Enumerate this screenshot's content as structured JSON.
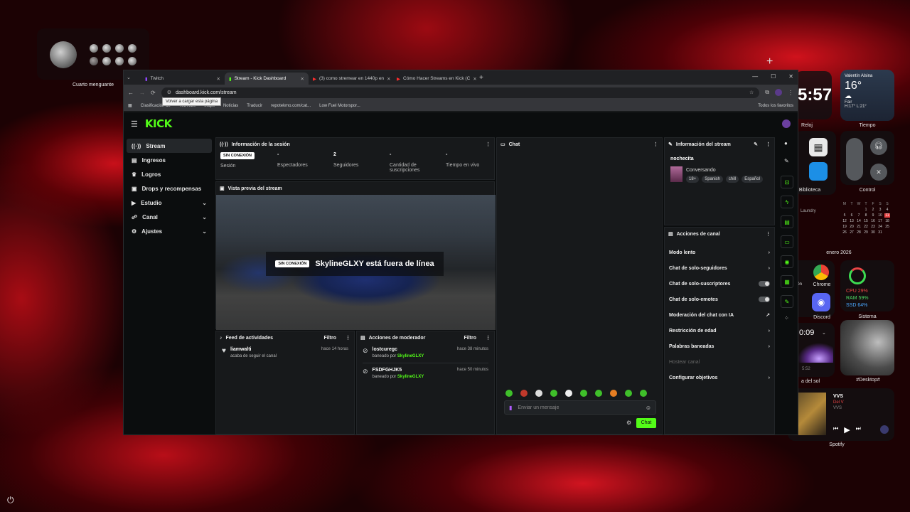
{
  "desktop": {
    "moon_label": "Cuarto menguante",
    "clock": {
      "time": "5:57",
      "label": "Reloj"
    },
    "weather": {
      "user": "Valentín Alsina",
      "temp": "16°",
      "cond": "Fair",
      "range": "H:17° L:21°",
      "label": "Tiempo"
    },
    "biblioteca_label": "Biblioteca",
    "control_label": "Control",
    "laundry": "Laundry",
    "calendar": {
      "label": "enero 2026",
      "days": [
        "M",
        "T",
        "W",
        "T",
        "F",
        "S",
        "S"
      ],
      "rows": [
        [
          "",
          "",
          "",
          "1",
          "2",
          "3",
          "4"
        ],
        [
          "5",
          "6",
          "7",
          "8",
          "9",
          "10",
          "11"
        ],
        [
          "12",
          "13",
          "14",
          "15",
          "16",
          "17",
          "18"
        ],
        [
          "19",
          "20",
          "21",
          "22",
          "23",
          "24",
          "25"
        ],
        [
          "26",
          "27",
          "28",
          "29",
          "30",
          "31",
          ""
        ]
      ]
    },
    "ion": "ión",
    "chrome_label": "Chrome",
    "discord_label": "Discord",
    "system": {
      "cpu": "CPU 29%",
      "ram": "RAM 59%",
      "ssd": "SSD 64%",
      "label": "Sistema"
    },
    "sun": {
      "time": "0:09",
      "sub": "5:52",
      "label": "a del sol"
    },
    "desktop_label": "#Desktop#",
    "spotify": {
      "title": "VVS",
      "artist": "Del V",
      "album": "VVS",
      "label": "Spotify"
    }
  },
  "browser": {
    "tabs": [
      "Twitch",
      "Stream - Kick Dashboard",
      "(3) como stremear en 1440p en",
      "Cómo Hacer Streams en Kick (C"
    ],
    "url": "dashboard.kick.com/stream",
    "tooltip": "Volver a cargar esta página",
    "bookmarks": [
      "Clasificación de",
      "YouTube",
      "Maps",
      "Noticias",
      "Traducir",
      "repotekmo.com/cat...",
      "Low Fuel Motorspor..."
    ],
    "all_bookmarks": "Todos los favoritos"
  },
  "kick": {
    "logo": "KICK",
    "sidebar": [
      "Stream",
      "Ingresos",
      "Logros",
      "Drops y recompensas",
      "Estudio",
      "Canal",
      "Ajustes"
    ],
    "session": {
      "title": "Información de la sesión",
      "status": "SIN CONEXIÓN",
      "stats": [
        {
          "value": "",
          "label": "Sesión"
        },
        {
          "value": "-",
          "label": "Espectadores"
        },
        {
          "value": "2",
          "label": "Seguidores"
        },
        {
          "value": "-",
          "label": "Cantidad de suscripciones"
        },
        {
          "value": "-",
          "label": "Tiempo en vivo"
        }
      ]
    },
    "preview": {
      "title": "Vista previa del stream",
      "badge": "SIN CONEXIÓN",
      "message": "SkylineGLXY está fuera de línea"
    },
    "feed": {
      "title": "Feed de actividades",
      "filter": "Filtro",
      "items": [
        {
          "name": "liamwalti",
          "sub": "acaba de seguir el canal",
          "time": "hace 14 horas"
        }
      ]
    },
    "mod": {
      "title": "Acciones de moderador",
      "filter": "Filtro",
      "items": [
        {
          "name": "lostcuregc",
          "sub": "baneado por",
          "by": "SkylineGLXY",
          "time": "hace 38 minutos"
        },
        {
          "name": "FSDFGHJK5",
          "sub": "baneado por",
          "by": "SkylineGLXY",
          "time": "hace 50 minutos"
        }
      ]
    },
    "chat": {
      "title": "Chat",
      "placeholder": "Enviar un mensaje",
      "send": "Chat"
    },
    "stream_info": {
      "title": "Información del stream",
      "name": "nochecita",
      "category": "Conversando",
      "tags": [
        "18+",
        "Spanish",
        "chill",
        "Español"
      ]
    },
    "channel_actions": {
      "title": "Acciones de canal",
      "items": [
        "Modo lento",
        "Chat de solo-seguidores",
        "Chat de solo-suscriptores",
        "Chat de solo-emotes",
        "Moderación del chat con IA",
        "Restricción de edad",
        "Palabras baneadas",
        "Hostear canal",
        "Configurar objetivos"
      ]
    }
  },
  "colors": {
    "kick_green": "#53fc18",
    "bg": "#0b0d0e",
    "panel": "#17191b"
  }
}
